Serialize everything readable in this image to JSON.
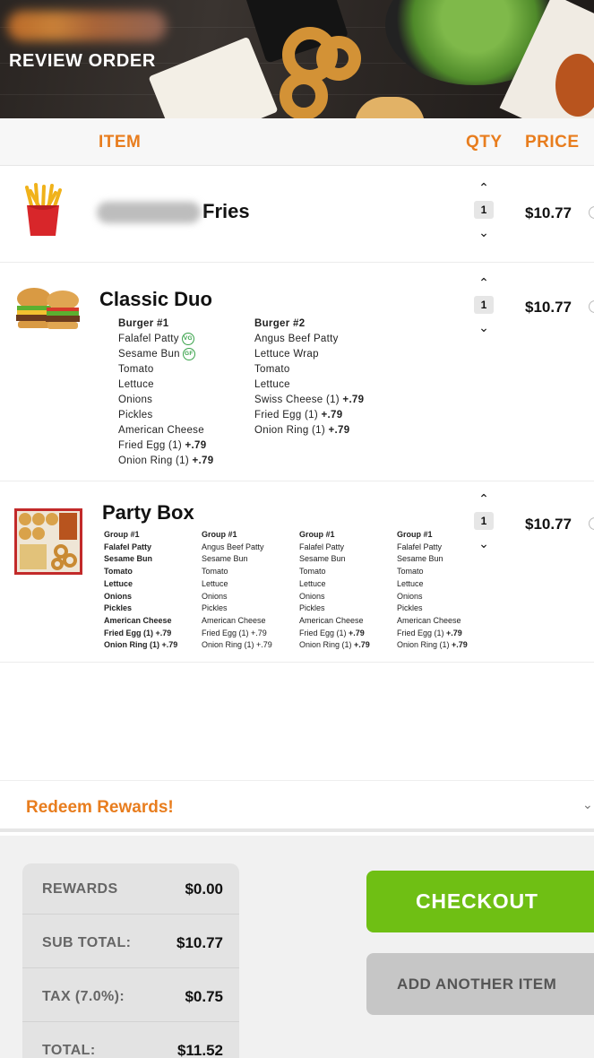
{
  "header": {
    "title": "REVIEW ORDER"
  },
  "columns": {
    "item": "ITEM",
    "qty": "QTY",
    "price": "PRICE"
  },
  "items": [
    {
      "name_suffix": "Fries",
      "qty": "1",
      "price": "$10.77",
      "icon": "fries-icon"
    },
    {
      "name": "Classic Duo",
      "qty": "1",
      "price": "$10.77",
      "icon": "burger-icon",
      "groups": [
        {
          "title": "Burger #1",
          "lines": [
            "Falafel Patty",
            "Sesame Bun",
            "Tomato",
            "Lettuce",
            "Onions",
            "Pickles",
            "American Cheese",
            "Fried Egg (1)",
            "Onion Ring (1)"
          ],
          "extras": [
            "",
            "",
            "",
            "",
            "",
            "",
            "",
            "+.79",
            "+.79"
          ],
          "badges": [
            "VG",
            "GF"
          ]
        },
        {
          "title": "Burger #2",
          "lines": [
            "Angus Beef Patty",
            "Lettuce Wrap",
            "Tomato",
            "Lettuce",
            "Swiss  Cheese (1)",
            "Fried Egg (1)",
            "Onion Ring (1)"
          ],
          "extras": [
            "",
            "",
            "",
            "",
            "+.79",
            "+.79",
            "+.79"
          ]
        }
      ]
    },
    {
      "name": "Party Box",
      "qty": "1",
      "price": "$10.77",
      "icon": "party-box-icon",
      "groups": [
        {
          "title": "Group #1",
          "lines": [
            "Falafel Patty",
            "Sesame Bun",
            "Tomato",
            "Lettuce",
            "Onions",
            "Pickles",
            "American Cheese",
            "Fried Egg (1)",
            "Onion Ring (1)"
          ],
          "extras": [
            "",
            "",
            "",
            "",
            "",
            "",
            "",
            "+.79",
            "+.79"
          ]
        },
        {
          "title": "Group #1",
          "lines": [
            "Angus Beef Patty",
            "Sesame Bun",
            "Tomato",
            "Lettuce",
            "Onions",
            "Pickles",
            "American Cheese",
            "Fried Egg (1)",
            "Onion Ring (1)"
          ],
          "extras": [
            "",
            "",
            "",
            "",
            "",
            "",
            "",
            "+.79",
            "+.79"
          ]
        },
        {
          "title": "Group #1",
          "lines": [
            "Falafel Patty",
            "Sesame Bun",
            "Tomato",
            "Lettuce",
            "Onions",
            "Pickles",
            "American Cheese",
            "Fried Egg (1)",
            "Onion Ring (1)"
          ],
          "extras": [
            "",
            "",
            "",
            "",
            "",
            "",
            "",
            "+.79",
            "+.79"
          ]
        },
        {
          "title": "Group #1",
          "lines": [
            "Falafel Patty",
            "Sesame Bun",
            "Tomato",
            "Lettuce",
            "Onions",
            "Pickles",
            "American Cheese",
            "Fried Egg (1)",
            "Onion Ring (1)"
          ],
          "extras": [
            "",
            "",
            "",
            "",
            "",
            "",
            "",
            "+.79",
            "+.79"
          ]
        }
      ]
    }
  ],
  "rewards": {
    "label": "Redeem Rewards!"
  },
  "summary": {
    "rewards_label": "REWARDS",
    "rewards_value": "$0.00",
    "subtotal_label": "SUB TOTAL:",
    "subtotal_value": "$10.77",
    "tax_label": "TAX (7.0%):",
    "tax_value": "$0.75",
    "total_label": "TOTAL:",
    "total_value": "$11.52"
  },
  "actions": {
    "checkout": "CHECKOUT",
    "add_item": "ADD ANOTHER ITEM"
  },
  "colors": {
    "accent": "#e87d1e",
    "checkout": "#6fbf14",
    "secondary_button": "#c6c6c6"
  }
}
